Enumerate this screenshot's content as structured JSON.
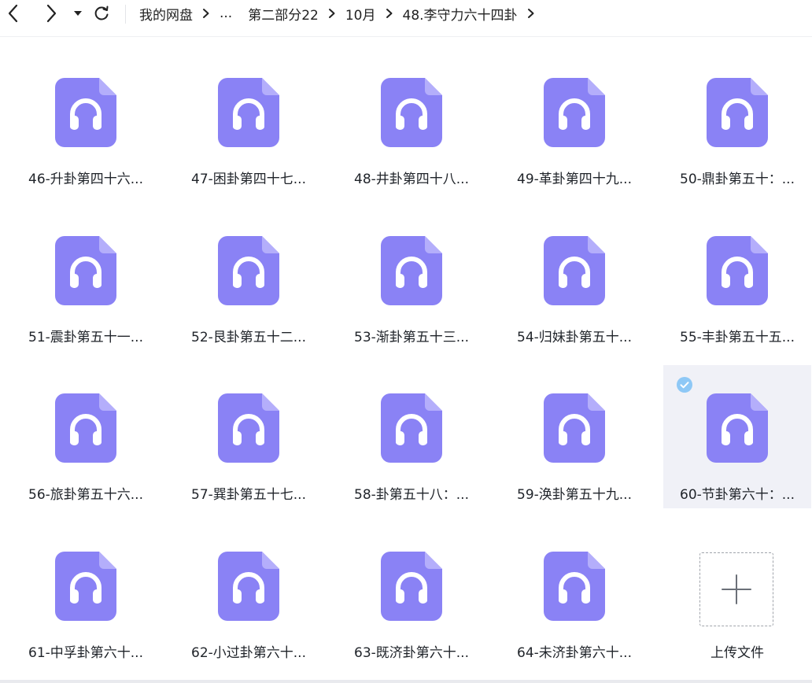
{
  "toolbar": {
    "back_icon": "chevron-left-icon",
    "forward_icon": "chevron-right-icon",
    "history_icon": "caret-down-icon",
    "refresh_icon": "refresh-icon"
  },
  "breadcrumb": [
    "我的网盘",
    "...",
    "第二部分22",
    "10月",
    "48.李守力六十四卦"
  ],
  "files": [
    {
      "name": "46-升卦第四十六..."
    },
    {
      "name": "47-困卦第四十七..."
    },
    {
      "name": "48-井卦第四十八..."
    },
    {
      "name": "49-革卦第四十九..."
    },
    {
      "name": "50-鼎卦第五十：..."
    },
    {
      "name": "51-震卦第五十一..."
    },
    {
      "name": "52-艮卦第五十二..."
    },
    {
      "name": "53-渐卦第五十三..."
    },
    {
      "name": "54-归妹卦第五十..."
    },
    {
      "name": "55-丰卦第五十五..."
    },
    {
      "name": "56-旅卦第五十六..."
    },
    {
      "name": "57-巽卦第五十七..."
    },
    {
      "name": "58-卦第五十八：..."
    },
    {
      "name": "59-涣卦第五十九..."
    },
    {
      "name": "60-节卦第六十：...",
      "selected": true
    },
    {
      "name": "61-中孚卦第六十..."
    },
    {
      "name": "62-小过卦第六十..."
    },
    {
      "name": "63-既济卦第六十..."
    },
    {
      "name": "64-未济卦第六十..."
    }
  ],
  "upload": {
    "label": "上传文件",
    "icon": "plus-icon"
  },
  "colors": {
    "file_icon": "#8a82f5",
    "selected_bg": "#f0f1f7",
    "check": "#8ec8f6"
  }
}
